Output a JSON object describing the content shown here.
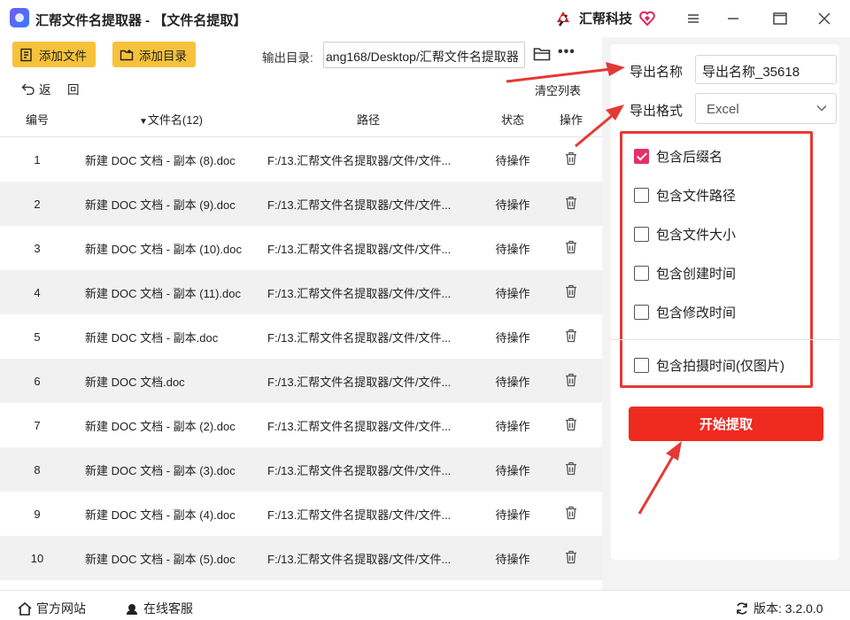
{
  "window": {
    "title": "汇帮文件名提取器 - 【文件名提取】",
    "brand_name": "汇帮科技"
  },
  "toolbar": {
    "add_file": "添加文件",
    "add_dir": "添加目录",
    "output_label": "输出目录:",
    "output_path": "ang168/Desktop/汇帮文件名提取器",
    "back": "返",
    "back2": "回",
    "clear_list": "清空列表"
  },
  "table": {
    "headers": {
      "num": "编号",
      "filename": "文件名(12)",
      "path": "路径",
      "status": "状态",
      "action": "操作"
    },
    "rows": [
      {
        "num": "1",
        "name": "新建 DOC 文档 - 副本 (8).doc",
        "path": "F:/13.汇帮文件名提取器/文件/文件...",
        "status": "待操作"
      },
      {
        "num": "2",
        "name": "新建 DOC 文档 - 副本 (9).doc",
        "path": "F:/13.汇帮文件名提取器/文件/文件...",
        "status": "待操作"
      },
      {
        "num": "3",
        "name": "新建 DOC 文档 - 副本 (10).doc",
        "path": "F:/13.汇帮文件名提取器/文件/文件...",
        "status": "待操作"
      },
      {
        "num": "4",
        "name": "新建 DOC 文档 - 副本 (11).doc",
        "path": "F:/13.汇帮文件名提取器/文件/文件...",
        "status": "待操作"
      },
      {
        "num": "5",
        "name": "新建 DOC 文档 - 副本.doc",
        "path": "F:/13.汇帮文件名提取器/文件/文件...",
        "status": "待操作"
      },
      {
        "num": "6",
        "name": "新建 DOC 文档.doc",
        "path": "F:/13.汇帮文件名提取器/文件/文件...",
        "status": "待操作"
      },
      {
        "num": "7",
        "name": "新建 DOC 文档 - 副本 (2).doc",
        "path": "F:/13.汇帮文件名提取器/文件/文件...",
        "status": "待操作"
      },
      {
        "num": "8",
        "name": "新建 DOC 文档 - 副本 (3).doc",
        "path": "F:/13.汇帮文件名提取器/文件/文件...",
        "status": "待操作"
      },
      {
        "num": "9",
        "name": "新建 DOC 文档 - 副本 (4).doc",
        "path": "F:/13.汇帮文件名提取器/文件/文件...",
        "status": "待操作"
      },
      {
        "num": "10",
        "name": "新建 DOC 文档 - 副本 (5).doc",
        "path": "F:/13.汇帮文件名提取器/文件/文件...",
        "status": "待操作"
      }
    ]
  },
  "side": {
    "export_name_label": "导出名称",
    "export_name_value": "导出名称_35618",
    "export_format_label": "导出格式",
    "export_format_value": "Excel",
    "options": [
      {
        "label": "包含后缀名",
        "checked": true
      },
      {
        "label": "包含文件路径",
        "checked": false
      },
      {
        "label": "包含文件大小",
        "checked": false
      },
      {
        "label": "包含创建时间",
        "checked": false
      },
      {
        "label": "包含修改时间",
        "checked": false
      },
      {
        "label": "包含拍摄时间(仅图片)",
        "checked": false
      }
    ],
    "start_button": "开始提取"
  },
  "statusbar": {
    "website": "官方网站",
    "service": "在线客服",
    "version": "版本: 3.2.0.0"
  },
  "colors": {
    "accent_yellow": "#f7c23b",
    "start_red": "#ef2a1f",
    "annotation_red": "#e53935",
    "checkbox_pink": "#e53066"
  }
}
